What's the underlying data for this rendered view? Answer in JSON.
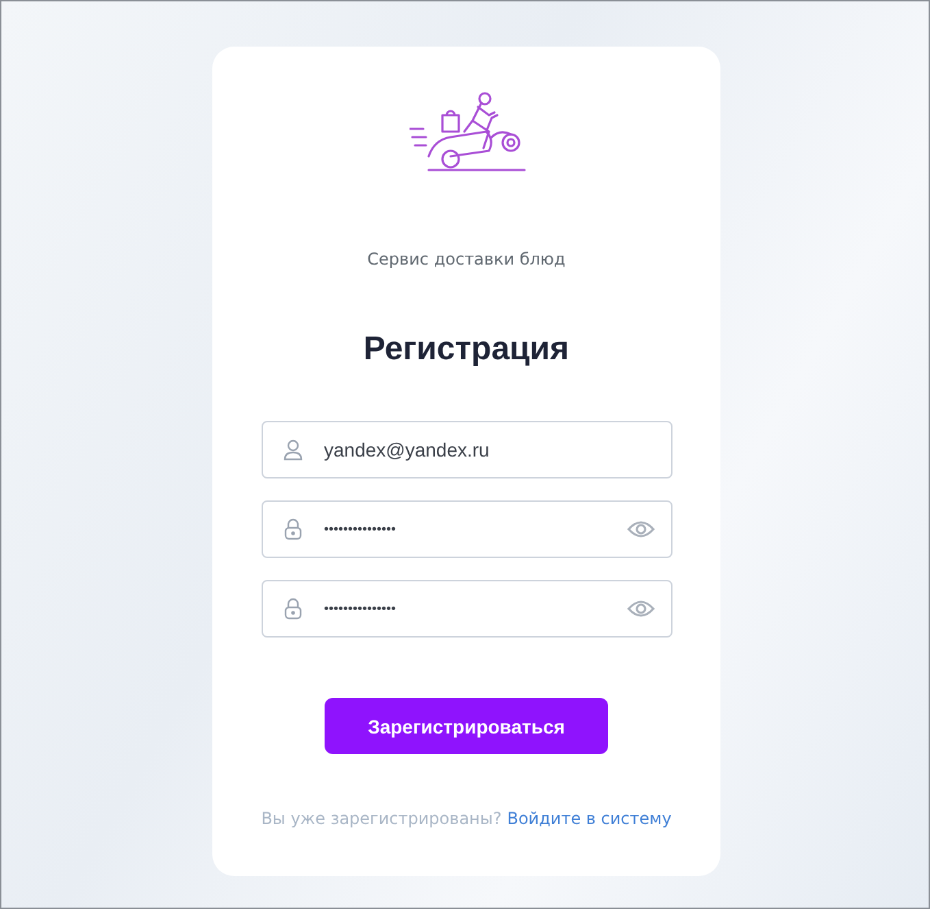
{
  "brand": {
    "tagline": "Сервис доставки блюд"
  },
  "title": "Регистрация",
  "fields": [
    {
      "kind": "email",
      "value": "yandex@yandex.ru"
    },
    {
      "kind": "password",
      "value": "•••••••••••••••"
    },
    {
      "kind": "password",
      "value": "•••••••••••••••"
    }
  ],
  "submit": "Зарегистрироваться",
  "footer": {
    "question": "Вы уже зарегистрированы?",
    "link": "Войдите в систему"
  }
}
